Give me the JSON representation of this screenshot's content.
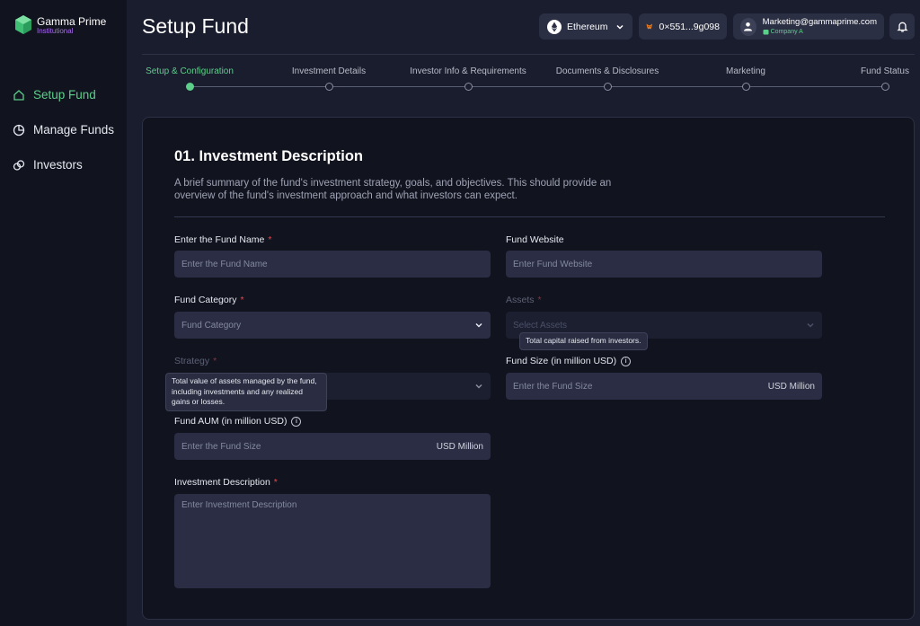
{
  "brand": {
    "name": "Gamma Prime",
    "sub": "Institutional",
    "accent": "#5ccf8a",
    "sub_color": "#a86bf0"
  },
  "sidebar": {
    "items": [
      {
        "label": "Setup Fund",
        "icon": "home-icon",
        "active": true
      },
      {
        "label": "Manage Funds",
        "icon": "pie-chart-icon",
        "active": false
      },
      {
        "label": "Investors",
        "icon": "link-icon",
        "active": false
      }
    ]
  },
  "header": {
    "title": "Setup Fund",
    "network": "Ethereum",
    "wallet": "0×551...9g098",
    "account_email": "Marketing@gammaprime.com",
    "account_company": "Company A"
  },
  "stepper": {
    "steps": [
      {
        "label": "Setup & Configuration",
        "active": true
      },
      {
        "label": "Investment Details",
        "active": false
      },
      {
        "label": "Investor Info & Requirements",
        "active": false
      },
      {
        "label": "Documents & Disclosures",
        "active": false
      },
      {
        "label": "Marketing",
        "active": false
      },
      {
        "label": "Fund Status",
        "active": false
      }
    ]
  },
  "form": {
    "title": "01. Investment Description",
    "description": "A brief summary of the fund's investment strategy, goals, and objectives. This should provide an overview of the fund's investment approach and what investors can expect.",
    "fund_name": {
      "label": "Enter the Fund Name",
      "placeholder": "Enter the Fund Name",
      "required": "*"
    },
    "fund_website": {
      "label": "Fund Website",
      "placeholder": "Enter Fund Website"
    },
    "fund_category": {
      "label": "Fund Category",
      "placeholder": "Fund Category",
      "required": "*"
    },
    "assets": {
      "label": "Assets",
      "placeholder": "Select Assets",
      "required": "*"
    },
    "strategy": {
      "label": "Strategy",
      "required": "*"
    },
    "fund_size": {
      "label": "Fund Size (in million USD)",
      "placeholder": "Enter the Fund Size",
      "suffix": "USD Million",
      "info": "i"
    },
    "fund_aum": {
      "label": "Fund AUM (in million USD)",
      "placeholder": "Enter the Fund Size",
      "suffix": "USD Million",
      "info": "i"
    },
    "investment_description": {
      "label": "Investment Description",
      "placeholder": "Enter Investment Description",
      "required": "*"
    }
  },
  "tooltips": {
    "fund_size": "Total capital raised from investors.",
    "aum": "Total value of assets managed by the fund, including investments and any realized gains or losses."
  }
}
